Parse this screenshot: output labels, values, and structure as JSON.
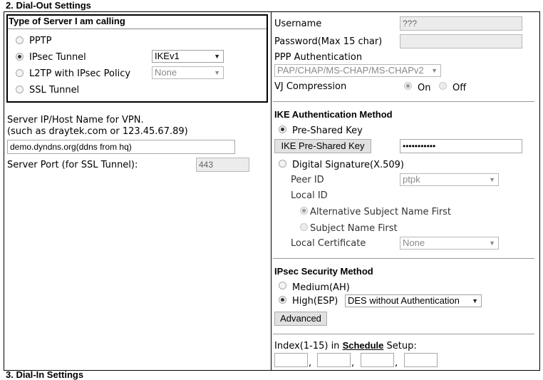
{
  "section_title": "2. Dial-Out Settings",
  "next_section_title": "3. Dial-In Settings",
  "server_type": {
    "title": "Type of Server I am calling",
    "options": [
      {
        "label": "PPTP",
        "checked": false
      },
      {
        "label": "IPsec Tunnel",
        "checked": true
      },
      {
        "label": "L2TP with IPsec Policy",
        "checked": false
      },
      {
        "label": "SSL Tunnel",
        "checked": false
      }
    ],
    "ipsec_select": "IKEv1",
    "l2tp_select": "None"
  },
  "server": {
    "label_line1": "Server IP/Host Name for VPN.",
    "label_line2": "(such as draytek.com or 123.45.67.89)",
    "host_value": "demo.dyndns.org(ddns from hq)",
    "port_label": "Server Port (for SSL Tunnel):",
    "port_value": "443"
  },
  "ppp": {
    "username_label": "Username",
    "username_value": "???",
    "password_label": "Password(Max 15 char)",
    "password_value": "",
    "auth_label": "PPP Authentication",
    "auth_value": "PAP/CHAP/MS-CHAP/MS-CHAPv2",
    "vj_label": "VJ Compression",
    "vj_on": "On",
    "vj_off": "Off"
  },
  "ike": {
    "title": "IKE Authentication Method",
    "psk_label": "Pre-Shared Key",
    "psk_button": "IKE Pre-Shared Key",
    "psk_value": "•••••••••••",
    "digsig_label": "Digital Signature(X.509)",
    "peer_id_label": "Peer ID",
    "peer_id_value": "ptpk",
    "local_id_label": "Local ID",
    "alt_subject_label": "Alternative Subject Name First",
    "subject_label": "Subject Name First",
    "local_cert_label": "Local Certificate",
    "local_cert_value": "None"
  },
  "ipsec": {
    "title": "IPsec Security Method",
    "medium_label": "Medium(AH)",
    "high_label": "High(ESP)",
    "high_select": "DES without Authentication",
    "advanced_button": "Advanced"
  },
  "schedule": {
    "prefix": "Index(1-15) in",
    "link": "Schedule",
    "suffix": "Setup:",
    "sep": ","
  }
}
